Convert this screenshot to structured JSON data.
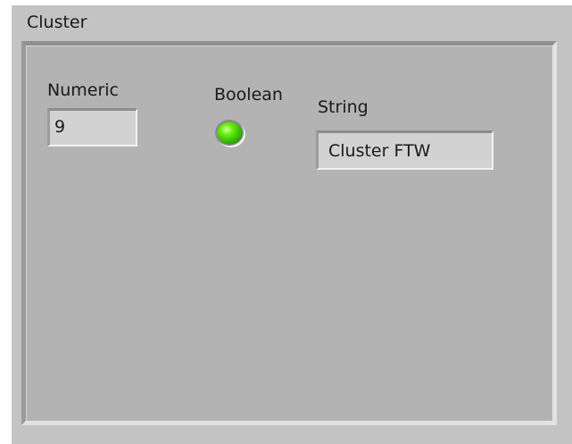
{
  "cluster": {
    "label": "Cluster",
    "controls": {
      "numeric": {
        "label": "Numeric",
        "value": "9"
      },
      "boolean": {
        "label": "Boolean",
        "state": "on",
        "led_color": "#33dd00"
      },
      "string": {
        "label": "String",
        "value": "Cluster FTW"
      }
    }
  },
  "colors": {
    "panel_background": "#c3c3c3",
    "cluster_background": "#b3b3b3",
    "indicator_background": "#d2d2d2"
  }
}
